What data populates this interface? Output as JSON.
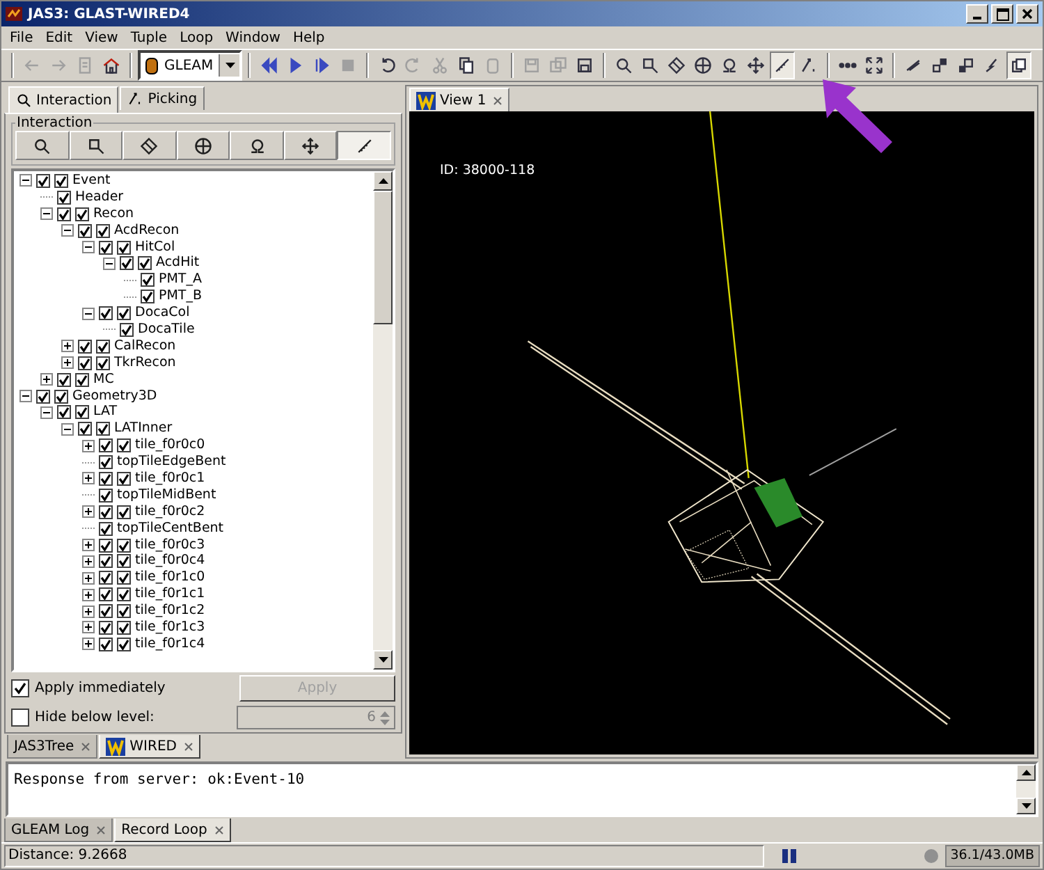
{
  "window": {
    "title": "JAS3: GLAST-WIRED4"
  },
  "menu": [
    "File",
    "Edit",
    "View",
    "Tuple",
    "Loop",
    "Window",
    "Help"
  ],
  "toolbar": [
    [
      {
        "disabled": true,
        "pressed": false
      },
      {
        "disabled": true,
        "pressed": false
      },
      {
        "disabled": true,
        "pressed": false
      },
      {
        "disabled": false,
        "pressed": false
      }
    ],
    [
      {
        "kind": "combo",
        "value": "GLEAM"
      }
    ],
    [
      {
        "disabled": false,
        "pressed": false
      },
      {
        "disabled": false,
        "pressed": false
      },
      {
        "disabled": false,
        "pressed": false
      },
      {
        "disabled": true,
        "pressed": false
      }
    ],
    [
      {
        "disabled": false,
        "pressed": false
      },
      {
        "disabled": true,
        "pressed": false
      },
      {
        "disabled": true,
        "pressed": false
      },
      {
        "disabled": false,
        "pressed": false
      },
      {
        "disabled": true,
        "pressed": false
      }
    ],
    [
      {
        "disabled": true,
        "pressed": false
      },
      {
        "disabled": true,
        "pressed": false
      },
      {
        "disabled": false,
        "pressed": false
      }
    ],
    [
      {
        "disabled": false,
        "pressed": false
      },
      {
        "disabled": false,
        "pressed": false
      },
      {
        "disabled": false,
        "pressed": false
      },
      {
        "disabled": false,
        "pressed": false
      },
      {
        "disabled": false,
        "pressed": false
      },
      {
        "disabled": false,
        "pressed": false
      },
      {
        "disabled": false,
        "pressed": true
      },
      {
        "disabled": false,
        "pressed": false
      }
    ],
    [
      {
        "disabled": false,
        "pressed": false
      },
      {
        "disabled": false,
        "pressed": false
      }
    ],
    [
      {
        "disabled": false,
        "pressed": false
      },
      {
        "disabled": false,
        "pressed": false
      },
      {
        "disabled": false,
        "pressed": false
      },
      {
        "disabled": false,
        "pressed": false
      },
      {
        "disabled": false,
        "pressed": true
      }
    ]
  ],
  "left_tabs": [
    {
      "label": "Interaction",
      "selected": true
    },
    {
      "label": "Picking",
      "selected": false
    }
  ],
  "interaction": {
    "title": "Interaction",
    "tools": [
      {
        "selected": false
      },
      {
        "selected": false
      },
      {
        "selected": false
      },
      {
        "selected": false
      },
      {
        "selected": false
      },
      {
        "selected": false
      },
      {
        "selected": true
      }
    ]
  },
  "tree": [
    {
      "label": "Event",
      "checked": true,
      "visible": true,
      "expanded": true,
      "children": [
        {
          "label": "Header",
          "checked": true
        },
        {
          "label": "Recon",
          "checked": true,
          "visible": true,
          "expanded": true,
          "children": [
            {
              "label": "AcdRecon",
              "checked": true,
              "visible": true,
              "expanded": true,
              "children": [
                {
                  "label": "HitCol",
                  "checked": true,
                  "visible": true,
                  "expanded": true,
                  "children": [
                    {
                      "label": "AcdHit",
                      "checked": true,
                      "visible": true,
                      "expanded": true,
                      "children": [
                        {
                          "label": "PMT_A",
                          "checked": true
                        },
                        {
                          "label": "PMT_B",
                          "checked": true
                        }
                      ]
                    }
                  ]
                },
                {
                  "label": "DocaCol",
                  "checked": true,
                  "visible": true,
                  "expanded": true,
                  "children": [
                    {
                      "label": "DocaTile",
                      "checked": true
                    }
                  ]
                }
              ]
            },
            {
              "label": "CalRecon",
              "checked": true,
              "visible": true,
              "expanded": false
            },
            {
              "label": "TkrRecon",
              "checked": true,
              "visible": true,
              "expanded": false
            }
          ]
        },
        {
          "label": "MC",
          "checked": true,
          "visible": true,
          "expanded": false
        }
      ]
    },
    {
      "label": "Geometry3D",
      "checked": true,
      "visible": true,
      "expanded": true,
      "children": [
        {
          "label": "LAT",
          "checked": true,
          "visible": true,
          "expanded": true,
          "children": [
            {
              "label": "LATInner",
              "checked": true,
              "visible": true,
              "expanded": true,
              "children": [
                {
                  "label": "tile_f0r0c0",
                  "checked": true,
                  "visible": true,
                  "expanded": false
                },
                {
                  "label": "topTileEdgeBent",
                  "checked": true
                },
                {
                  "label": "tile_f0r0c1",
                  "checked": true,
                  "visible": true,
                  "expanded": false
                },
                {
                  "label": "topTileMidBent",
                  "checked": true
                },
                {
                  "label": "tile_f0r0c2",
                  "checked": true,
                  "visible": true,
                  "expanded": false
                },
                {
                  "label": "topTileCentBent",
                  "checked": true
                },
                {
                  "label": "tile_f0r0c3",
                  "checked": true,
                  "visible": true,
                  "expanded": false
                },
                {
                  "label": "tile_f0r0c4",
                  "checked": true,
                  "visible": true,
                  "expanded": false
                },
                {
                  "label": "tile_f0r1c0",
                  "checked": true,
                  "visible": true,
                  "expanded": false
                },
                {
                  "label": "tile_f0r1c1",
                  "checked": true,
                  "visible": true,
                  "expanded": false
                },
                {
                  "label": "tile_f0r1c2",
                  "checked": true,
                  "visible": true,
                  "expanded": false
                },
                {
                  "label": "tile_f0r1c3",
                  "checked": true,
                  "visible": true,
                  "expanded": false
                },
                {
                  "label": "tile_f0r1c4",
                  "checked": true,
                  "visible": true,
                  "expanded": false
                }
              ]
            }
          ]
        }
      ]
    }
  ],
  "apply_immediately": {
    "label": "Apply immediately",
    "checked": true
  },
  "apply_button": {
    "label": "Apply",
    "disabled": true
  },
  "hide_below": {
    "label": "Hide below level:",
    "checked": false,
    "value": "6",
    "disabled": true
  },
  "left_bottom_tabs": [
    {
      "label": "JAS3Tree",
      "selected": false,
      "logo": false
    },
    {
      "label": "WIRED",
      "selected": true,
      "logo": true
    }
  ],
  "view_tabs": [
    {
      "label": "View 1",
      "selected": true
    }
  ],
  "view": {
    "event_id": "ID: 38000-118"
  },
  "console": {
    "text": "Response from server: ok:Event-10"
  },
  "console_tabs": [
    {
      "label": "GLEAM Log",
      "selected": false
    },
    {
      "label": "Record Loop",
      "selected": true
    }
  ],
  "status_bar": {
    "distance": "Distance: 9.2668",
    "memory": "36.1/43.0MB"
  }
}
